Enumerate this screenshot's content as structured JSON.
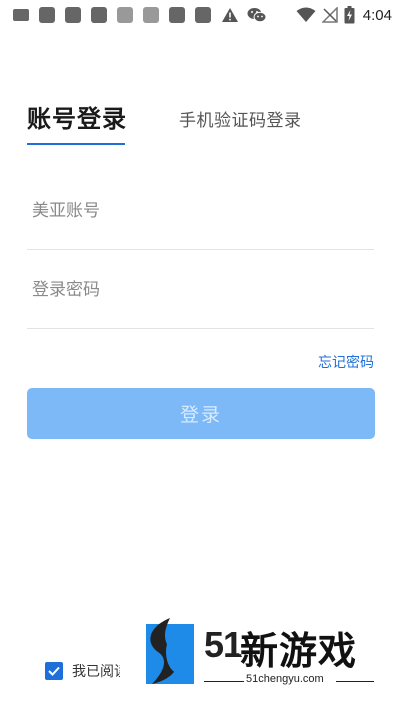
{
  "status_bar": {
    "time": "4:04",
    "left_icons": [
      "keyboard-icon",
      "app-icon",
      "app-icon",
      "app-icon",
      "app-icon",
      "app-icon",
      "app-icon",
      "app-icon",
      "warning-icon",
      "wechat-icon"
    ],
    "right_icons": [
      "wifi-icon",
      "no-signal-icon",
      "battery-charging-icon"
    ]
  },
  "tabs": {
    "account_login": "账号登录",
    "sms_login": "手机验证码登录"
  },
  "form": {
    "account_placeholder": "美亚账号",
    "password_placeholder": "登录密码",
    "forgot_password": "忘记密码",
    "login_button": "登录"
  },
  "agreement": {
    "checked": true,
    "text": "我已阅读"
  },
  "watermark": {
    "number": "51",
    "name": "新游戏",
    "url": "51chengyu.com"
  },
  "colors": {
    "accent": "#1f6fd9",
    "button_disabled": "#7db8f7",
    "divider": "#e3e3e3"
  }
}
